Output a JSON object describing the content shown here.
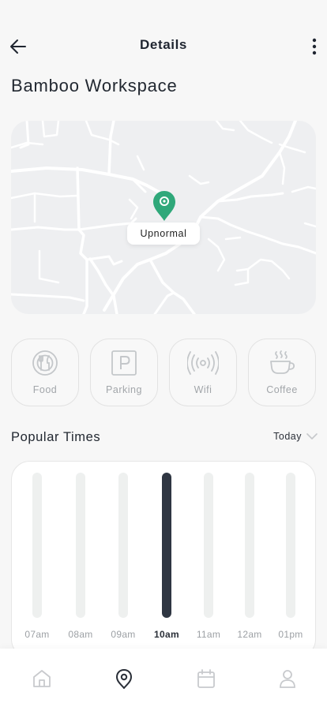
{
  "header": {
    "title": "Details",
    "back_icon": "arrow-left-icon",
    "more_icon": "more-vertical-icon"
  },
  "place": {
    "name": "Bamboo Workspace"
  },
  "map": {
    "marker_label": "Upnormal",
    "marker_color": "#2fa87a",
    "marker_icon": "map-pin-icon"
  },
  "amenities": [
    {
      "label": "Food",
      "icon": "food-plate-icon"
    },
    {
      "label": "Parking",
      "icon": "parking-icon"
    },
    {
      "label": "Wifi",
      "icon": "wifi-signal-icon"
    },
    {
      "label": "Coffee",
      "icon": "coffee-cup-icon"
    }
  ],
  "popular_times": {
    "title": "Popular Times",
    "filter": "Today",
    "filter_icon": "chevron-down-icon"
  },
  "chart_data": {
    "type": "bar",
    "categories": [
      "07am",
      "08am",
      "09am",
      "10am",
      "11am",
      "12am",
      "01pm"
    ],
    "highlighted": "10am",
    "colors": {
      "active": "#2f3642",
      "inactive": "#eef0ef"
    }
  },
  "nav": [
    {
      "icon": "home-icon",
      "active": false
    },
    {
      "icon": "location-icon",
      "active": true
    },
    {
      "icon": "calendar-icon",
      "active": false
    },
    {
      "icon": "profile-icon",
      "active": false
    }
  ]
}
